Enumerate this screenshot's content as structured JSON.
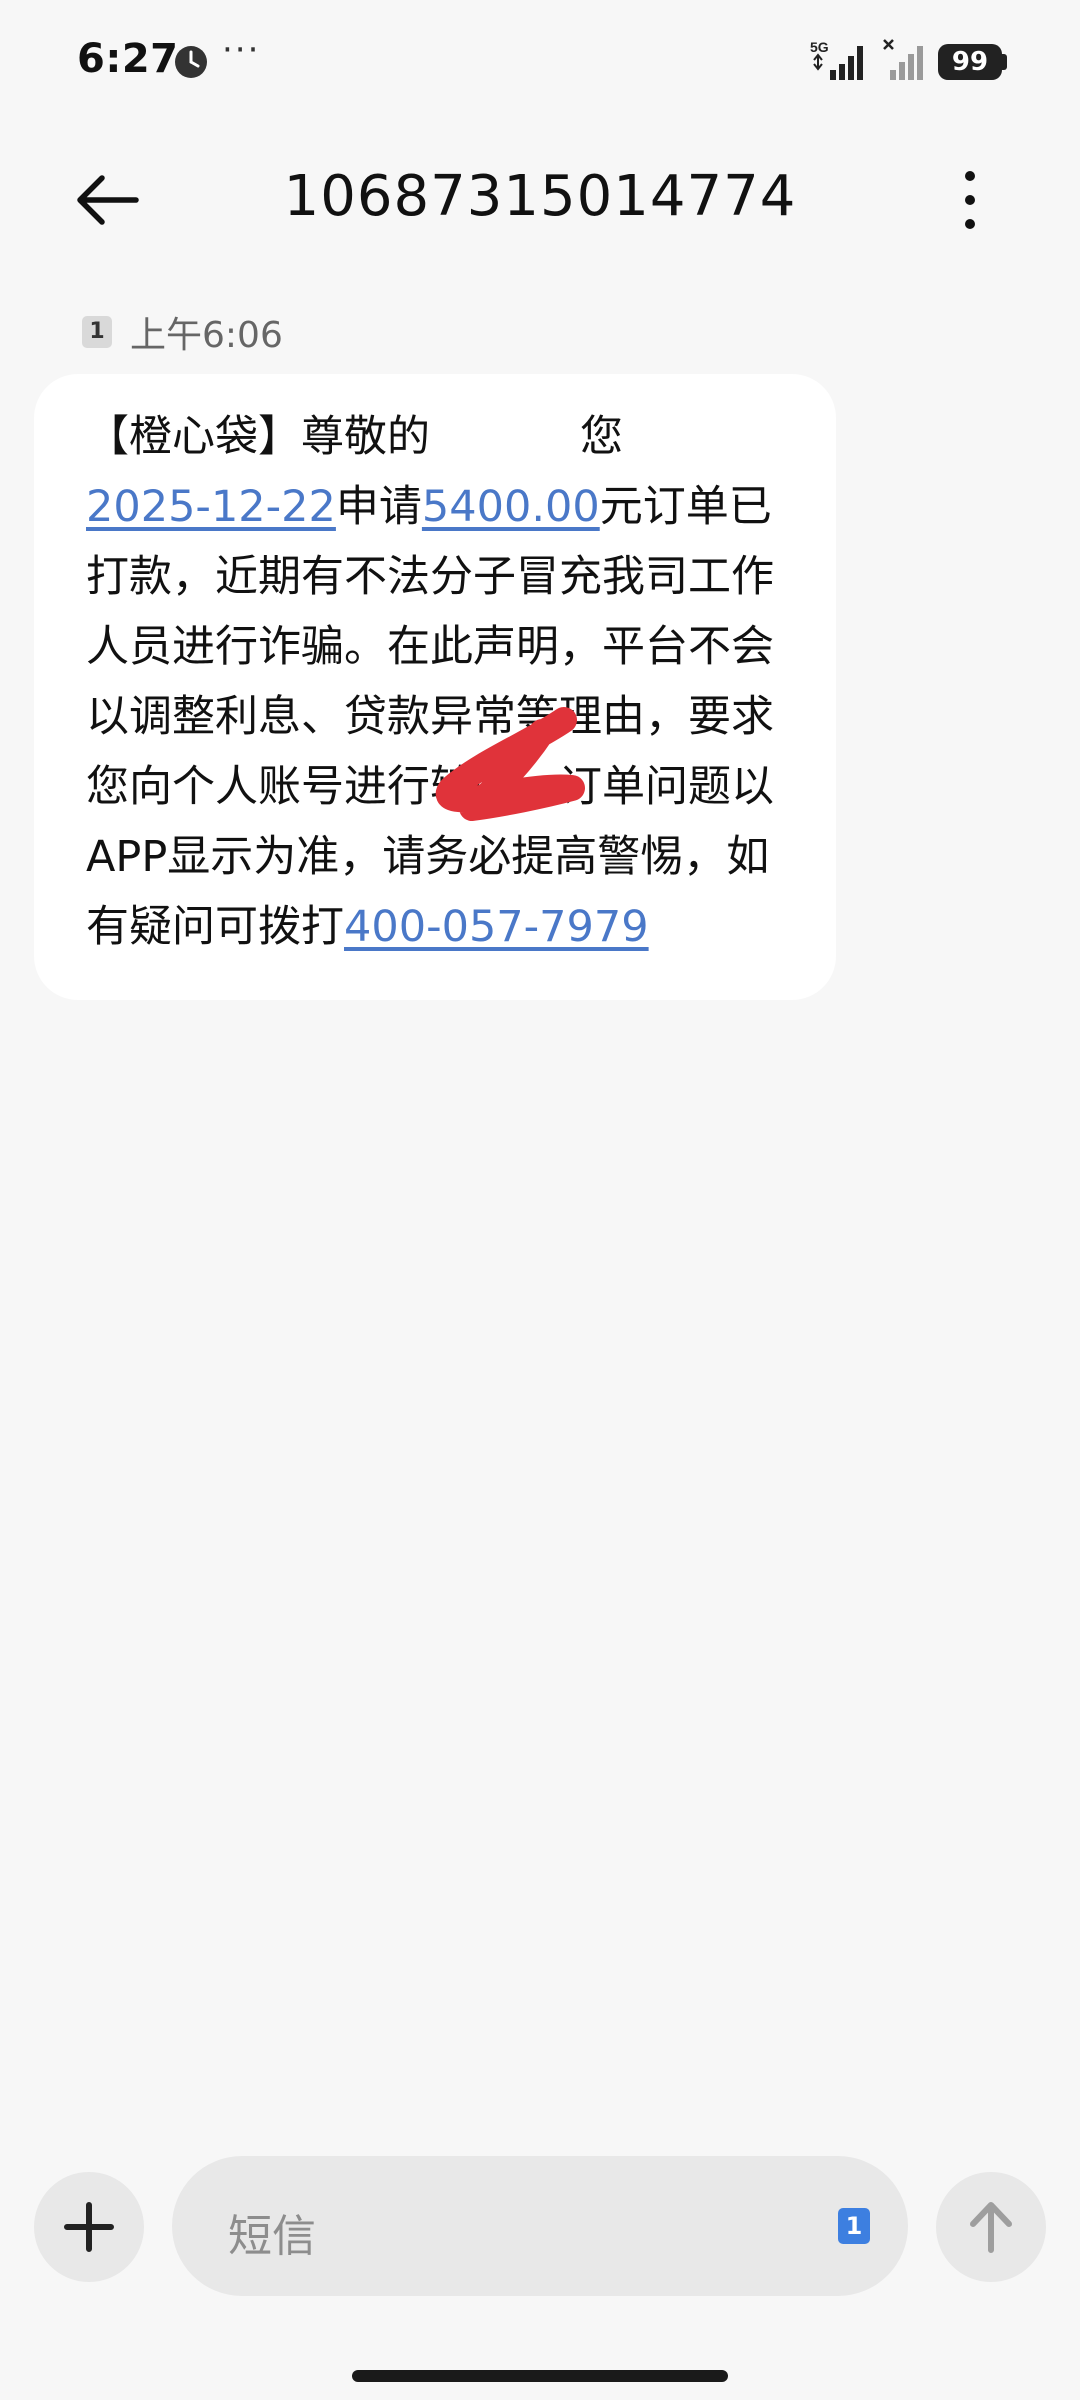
{
  "status_bar": {
    "time": "6:27",
    "more": "···",
    "network": "5G",
    "battery": "99",
    "icons": [
      "clock-icon",
      "signal-5g-icon",
      "signal-no-sim-icon",
      "battery-icon"
    ]
  },
  "header": {
    "title": "10687315014774",
    "icons": [
      "back-arrow-icon",
      "more-vertical-icon"
    ]
  },
  "message": {
    "sim": "1",
    "time": "上午6:06",
    "segments": {
      "part1": "【橙心袋】尊敬的",
      "part2": "您",
      "date_link": "2025-12-22",
      "part3": "申请",
      "amount_link": "5400.00",
      "part4": "元订单已打款，近期有不法分子冒充我司工作人员进行诈骗。在此声明，平台不会以调整利息、贷款异常等理由，要求您向个人账号进行转账，订单问题以APP显示为准，请务必提高警惕，如有疑问可拨打",
      "phone_link": "400-057-7979"
    },
    "link_color": "#4a78c8",
    "redaction_color": "#e0333a"
  },
  "composer": {
    "placeholder": "短信",
    "sim": "1",
    "icons": [
      "plus-icon",
      "send-arrow-icon"
    ],
    "sim_color": "#3d7fe0"
  }
}
